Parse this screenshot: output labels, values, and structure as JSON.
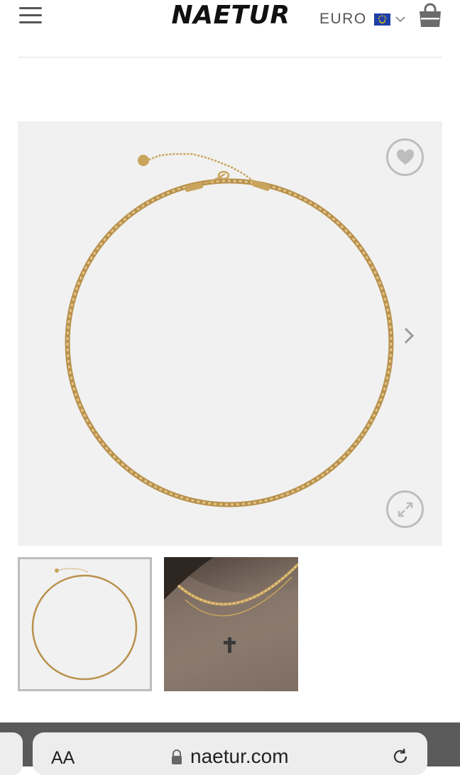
{
  "header": {
    "logo": "NAETUR",
    "currency": "EURO",
    "flag_icon": "eu-flag-icon",
    "menu_icon": "hamburger-menu-icon",
    "cart_icon": "shopping-bag-icon",
    "dropdown_icon": "chevron-down-icon"
  },
  "product_gallery": {
    "wishlist_icon": "heart-icon",
    "next_icon": "chevron-right-icon",
    "zoom_icon": "expand-icon",
    "thumbnails": [
      "necklace-product-thumbnail",
      "necklace-model-thumbnail"
    ]
  },
  "browser": {
    "text_size_label": "AA",
    "url": "naetur.com",
    "lock_icon": "lock-icon",
    "reload_icon": "reload-icon"
  },
  "colors": {
    "accent_blue": "#1f3fa8",
    "gold": "#c9a45c",
    "background_gray": "#f1f1f1"
  }
}
